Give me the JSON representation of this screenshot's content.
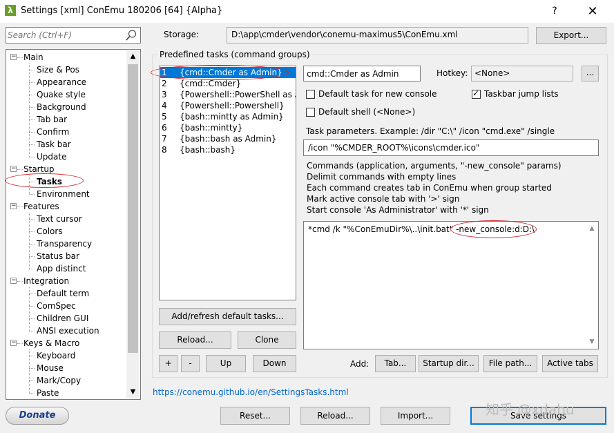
{
  "window": {
    "title": "Settings [xml] ConEmu 180206 [64] {Alpha}",
    "app_icon": "λ",
    "help_glyph": "?",
    "close_glyph": "✕"
  },
  "search": {
    "placeholder": "Search (Ctrl+F)"
  },
  "tree": {
    "expander_minus": "−",
    "groups": [
      {
        "label": "Main",
        "children": [
          "Size & Pos",
          "Appearance",
          "Quake style",
          "Background",
          "Tab bar",
          "Confirm",
          "Task bar",
          "Update"
        ]
      },
      {
        "label": "Startup",
        "children": [
          "Tasks",
          "Environment"
        ]
      },
      {
        "label": "Features",
        "children": [
          "Text cursor",
          "Colors",
          "Transparency",
          "Status bar",
          "App distinct"
        ]
      },
      {
        "label": "Integration",
        "children": [
          "Default term",
          "ComSpec",
          "Children GUI",
          "ANSI execution"
        ]
      },
      {
        "label": "Keys & Macro",
        "children": [
          "Keyboard",
          "Mouse",
          "Mark/Copy",
          "Paste"
        ]
      }
    ],
    "selected": "Tasks",
    "scroll_up": "▲",
    "scroll_down": "▼"
  },
  "storage": {
    "label": "Storage:",
    "value": "D:\\app\\cmder\\vendor\\conemu-maximus5\\ConEmu.xml",
    "export_label": "Export..."
  },
  "tasks": {
    "group_label": "Predefined tasks (command groups)",
    "items": [
      {
        "num": "1",
        "name": "{cmd::Cmder as Admin}",
        "selected": true
      },
      {
        "num": "2",
        "name": "{cmd::Cmder}"
      },
      {
        "num": "3",
        "name": "{Powershell::PowerShell as A"
      },
      {
        "num": "4",
        "name": "{Powershell::Powershell}"
      },
      {
        "num": "5",
        "name": "{bash::mintty as Admin}"
      },
      {
        "num": "6",
        "name": "{bash::mintty}"
      },
      {
        "num": "7",
        "name": "{bash::bash as Admin}"
      },
      {
        "num": "8",
        "name": "{bash::bash}"
      }
    ],
    "add_refresh_label": "Add/refresh default tasks...",
    "reload_label": "Reload...",
    "clone_label": "Clone",
    "plus_label": "+",
    "minus_label": "-",
    "up_label": "Up",
    "down_label": "Down"
  },
  "task_detail": {
    "name_value": "cmd::Cmder as Admin",
    "hotkey_label": "Hotkey:",
    "hotkey_value": "<None>",
    "hotkey_browse": "...",
    "default_task_label": "Default task for new console",
    "default_task_checked": false,
    "jump_lists_label": "Taskbar jump lists",
    "jump_lists_checked": true,
    "default_shell_label": "Default shell (<None>)",
    "default_shell_checked": false,
    "params_label": "Task parameters. Example: /dir \"C:\\\" /icon \"cmd.exe\" /single",
    "params_value": "/icon \"%CMDER_ROOT%\\icons\\cmder.ico\"",
    "help_lines": [
      "Commands (application, arguments, \"-new_console\" params)",
      "Delimit commands with empty lines",
      "Each command creates tab in ConEmu when group started",
      "Mark active console tab with '>' sign",
      "Start console 'As Administrator' with '*' sign"
    ],
    "commands_value": "*cmd /k \"%ConEmuDir%\\..\\init.bat\"  -new_console:d:D:\\",
    "scroll_up": "▲",
    "scroll_down": "▼"
  },
  "add_bar": {
    "label": "Add:",
    "tab_label": "Tab...",
    "startup_dir_label": "Startup dir...",
    "file_path_label": "File path...",
    "active_tabs_label": "Active tabs"
  },
  "help_link": "https://conemu.github.io/en/SettingsTasks.html",
  "bottom": {
    "donate_label": "Donate",
    "reset_label": "Reset...",
    "reload_label": "Reload...",
    "import_label": "Import...",
    "save_label": "Save settings"
  },
  "watermark": "知乎 @xdahu",
  "colors": {
    "selection": "#0078d7",
    "annotation": "#d0262b",
    "link": "#0066cc"
  }
}
